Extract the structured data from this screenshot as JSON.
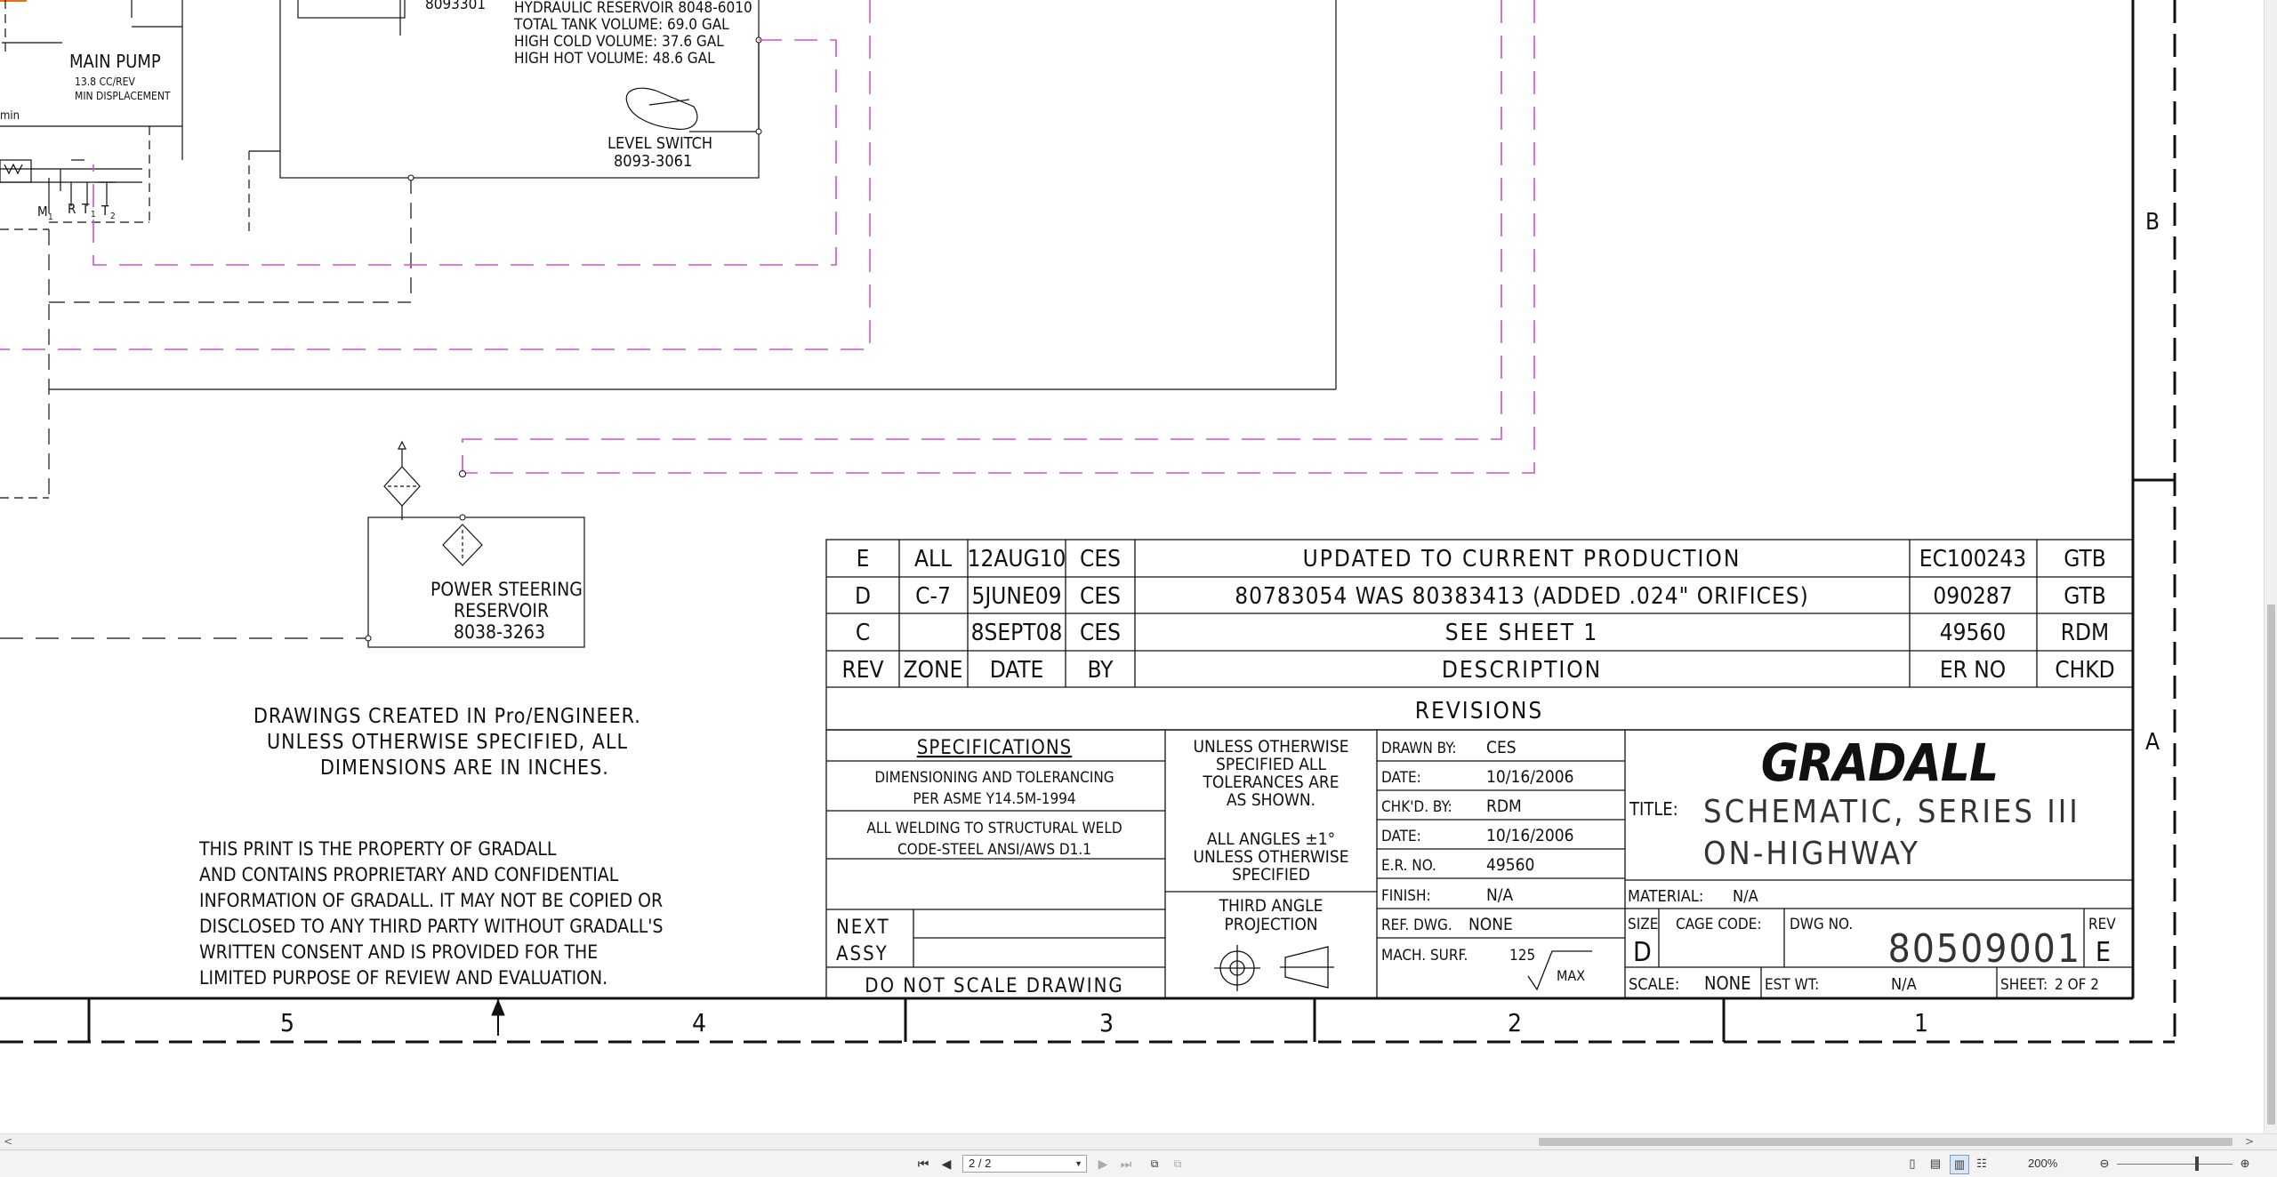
{
  "drawing": {
    "hydraulic_reservoir": [
      "HYDRAULIC RESERVOIR 8048-6010",
      "TOTAL TANK VOLUME: 69.0 GAL",
      "HIGH COLD VOLUME: 37.6 GAL",
      "HIGH HOT VOLUME: 48.6 GAL"
    ],
    "partial_number": "8093301",
    "main_pump": {
      "label": "MAIN PUMP",
      "line1": "13.8 CC/REV",
      "line2": "MIN DISPLACEMENT",
      "min": "min"
    },
    "port_labels": {
      "m1": "M",
      "m1_sub": "1",
      "r": "R",
      "t": "T",
      "t1_sub": "1",
      "t2": "T",
      "t2_sub": "2"
    },
    "level_switch": {
      "label": "LEVEL SWITCH",
      "part": "8093-3061"
    },
    "power_steering": {
      "line1": "POWER STEERING",
      "line2": "RESERVOIR",
      "part": "8038-3263"
    },
    "creo_note": [
      "DRAWINGS CREATED IN Pro/ENGINEER.",
      "UNLESS OTHERWISE SPECIFIED, ALL",
      "DIMENSIONS ARE IN INCHES."
    ],
    "property_note": [
      "THIS PRINT IS THE PROPERTY OF GRADALL",
      "AND CONTAINS PROPRIETARY AND CONFIDENTIAL",
      "INFORMATION OF GRADALL. IT MAY NOT BE COPIED OR",
      "DISCLOSED TO ANY THIRD PARTY WITHOUT GRADALL'S",
      "WRITTEN CONSENT AND IS PROVIDED FOR THE",
      "LIMITED PURPOSE OF REVIEW AND EVALUATION."
    ],
    "zone_numbers": [
      "5",
      "4",
      "3",
      "2",
      "1"
    ],
    "zone_letters": [
      "B",
      "A"
    ]
  },
  "revisions": {
    "title": "REVISIONS",
    "header": [
      "REV",
      "ZONE",
      "DATE",
      "BY",
      "DESCRIPTION",
      "ER NO",
      "CHKD"
    ],
    "rows": [
      [
        "E",
        "ALL",
        "12AUG10",
        "CES",
        "UPDATED TO CURRENT PRODUCTION",
        "EC100243",
        "GTB"
      ],
      [
        "D",
        "C-7",
        "5JUNE09",
        "CES",
        "80783054 WAS 80383413 (ADDED .024\" ORIFICES)",
        "090287",
        "GTB"
      ],
      [
        "C",
        "",
        "8SEPT08",
        "CES",
        "SEE SHEET 1",
        "49560",
        "RDM"
      ]
    ]
  },
  "specifications": {
    "title": "SPECIFICATIONS",
    "line1a": "DIMENSIONING AND TOLERANCING",
    "line1b": "PER ASME Y14.5M-1994",
    "line2a": "ALL WELDING TO STRUCTURAL WELD",
    "line2b": "CODE-STEEL ANSI/AWS D1.1",
    "next_assy_1": "NEXT",
    "next_assy_2": "ASSY",
    "do_not_scale": "DO NOT SCALE DRAWING"
  },
  "tolerances": {
    "lines": [
      "UNLESS OTHERWISE",
      "SPECIFIED ALL",
      "TOLERANCES ARE",
      "AS SHOWN."
    ],
    "angles": [
      "ALL ANGLES ±1°",
      "UNLESS OTHERWISE",
      "SPECIFIED"
    ],
    "projection": [
      "THIRD ANGLE",
      "PROJECTION"
    ]
  },
  "signoff": {
    "drawn_by_label": "DRAWN BY:",
    "drawn_by": "CES",
    "date1_label": "DATE:",
    "date1": "10/16/2006",
    "chkd_by_label": "CHK'D. BY:",
    "chkd_by": "RDM",
    "date2_label": "DATE:",
    "date2": "10/16/2006",
    "er_no_label": "E.R. NO.",
    "er_no": "49560",
    "finish_label": "FINISH:",
    "finish": "N/A",
    "ref_dwg_label": "REF. DWG.",
    "ref_dwg": "NONE",
    "mach_surf_label": "MACH. SURF.",
    "mach_surf": "125",
    "max": "MAX"
  },
  "titleblock": {
    "company": "GRADALL",
    "title_label": "TITLE:",
    "title_line1": "SCHEMATIC, SERIES III",
    "title_line2": "ON-HIGHWAY",
    "material_label": "MATERIAL:",
    "material": "N/A",
    "size_label": "SIZE",
    "size": "D",
    "cage_label": "CAGE CODE:",
    "dwg_label": "DWG NO.",
    "dwg_no": "80509001",
    "rev_label": "REV",
    "rev": "E",
    "scale_label": "SCALE:",
    "scale": "NONE",
    "wt_label": "EST WT:",
    "wt": "N/A",
    "sheet_label": "SHEET:",
    "sheet": "2 OF 2"
  },
  "viewer": {
    "page_indicator": "2 / 2",
    "zoom": "200%"
  },
  "colors": {
    "magenta_line": "#d050d0",
    "ink": "#111111"
  }
}
